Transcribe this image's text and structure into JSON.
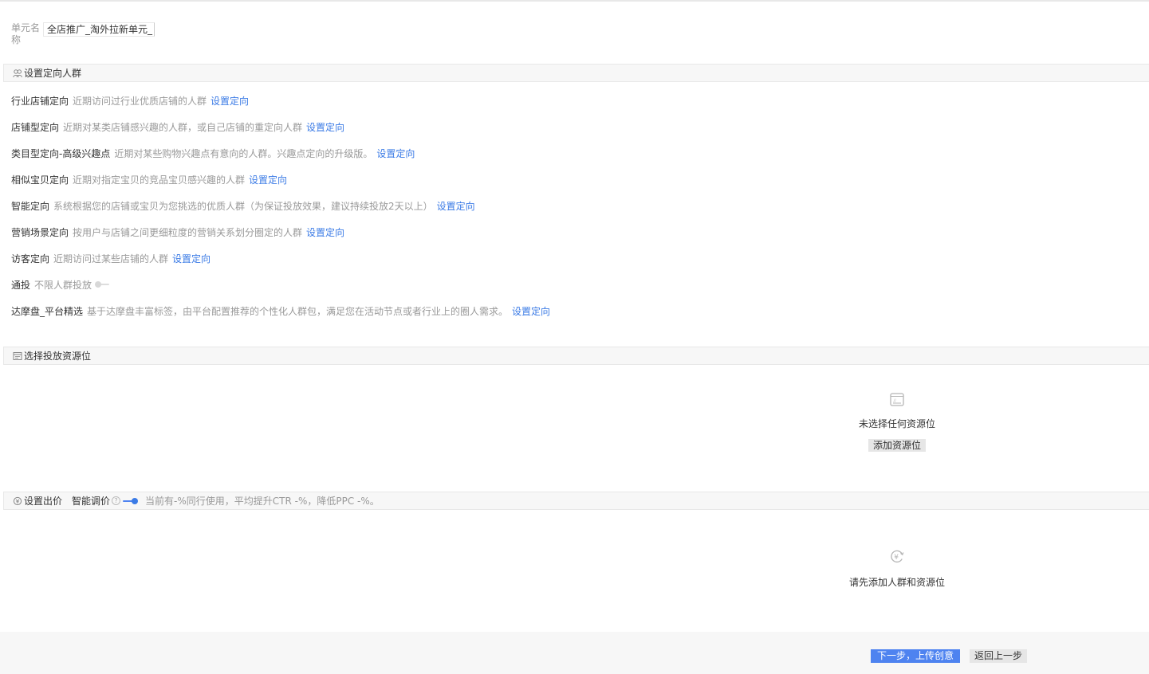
{
  "unit": {
    "label": "单元名称",
    "value": "全店推广_淘外拉新单元_"
  },
  "targeting": {
    "header": "设置定向人群",
    "action_label": "设置定向",
    "rows": [
      {
        "name": "行业店铺定向",
        "desc": "近期访问过行业优质店铺的人群",
        "link": "设置定向"
      },
      {
        "name": "店铺型定向",
        "desc": "近期对某类店铺感兴趣的人群，或自己店铺的重定向人群",
        "link": "设置定向"
      },
      {
        "name": "类目型定向-高级兴趣点",
        "desc": "近期对某些购物兴趣点有意向的人群。兴趣点定向的升级版。",
        "link": "设置定向"
      },
      {
        "name": "相似宝贝定向",
        "desc": "近期对指定宝贝的竞品宝贝感兴趣的人群",
        "link": "设置定向"
      },
      {
        "name": "智能定向",
        "desc": "系统根据您的店铺或宝贝为您挑选的优质人群（为保证投放效果，建议持续投放2天以上）",
        "link": "设置定向"
      },
      {
        "name": "营销场景定向",
        "desc": "按用户与店铺之间更细粒度的营销关系划分圈定的人群",
        "link": "设置定向"
      },
      {
        "name": "访客定向",
        "desc": "近期访问过某些店铺的人群",
        "link": "设置定向"
      },
      {
        "name": "通投",
        "desc": "不限人群投放",
        "toggle": "off"
      },
      {
        "name": "达摩盘_平台精选",
        "desc": "基于达摩盘丰富标签，由平台配置推荐的个性化人群包，满足您在活动节点或者行业上的圈人需求。",
        "link": "设置定向"
      }
    ]
  },
  "placement": {
    "header": "选择投放资源位",
    "empty_text": "未选择任何资源位",
    "add_button": "添加资源位"
  },
  "bid": {
    "header": "设置出价",
    "smart_label": "智能调价",
    "help_glyph": "?",
    "toggle": "on",
    "note": "当前有-%同行使用，平均提升CTR -%，降低PPC -%。",
    "empty_text": "请先添加人群和资源位"
  },
  "footer": {
    "next_button": "下一步，上传创意",
    "back_button": "返回上一步"
  },
  "colors": {
    "accent": "#3b7be6",
    "primary_button": "#4e83f0",
    "header_bg": "#f7f7f7"
  },
  "icons": {
    "targeting": "people-icon",
    "placement": "layout-icon",
    "bid": "bid-icon",
    "placement_empty": "empty-window-icon",
    "bid_empty": "yuan-refresh-icon"
  }
}
